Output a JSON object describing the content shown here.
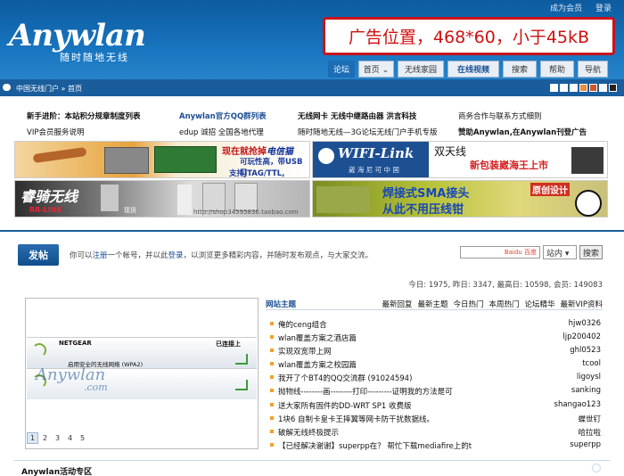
{
  "header": {
    "top_links": [
      "成为会员",
      "登录"
    ],
    "logo_text": "Anywlan",
    "logo_sub": "随时随地无线",
    "ad_text": "广告位置，468*60，小于45kB"
  },
  "nav": [
    "论坛",
    "首页 ⌄",
    "无线家园",
    "在线视频",
    "搜索",
    "帮助",
    "导航"
  ],
  "breadcrumb": "中国无线门户 » 首页",
  "swatch_colors": [
    "#ffffff",
    "#ffffff",
    "#ffffff",
    "#f18a3c",
    "#d6542b",
    "#ffffff",
    "#222222"
  ],
  "links": {
    "row1": [
      "新手进阶：本站积分规章制度列表",
      "Anywlan官方QQ群列表",
      "无线网卡 无线中继路由器 洪言科技",
      "商务合作与联系方式细则"
    ],
    "row2": [
      "VIP会员服务说明",
      "edup 诚招 全国各地代理",
      "随时随地无线—3G论坛无线门户手机专版",
      "赞助Anywlan,在Anywlan刊登广告"
    ]
  },
  "banners": {
    "b1_line1": "现在就抢掉",
    "b1_brand": "电信猫",
    "b1_line2": "可玩性高，带USB口",
    "b1_line3": "支持JTAG/TTL, Telnet",
    "b2_brand": "WIFI-Link",
    "b2_sub": "崴 海 尼 可 中 国",
    "b2_tag": "双天线",
    "b2_slogan": "新包装崴海王上市",
    "b3_title": "睿骑无线",
    "b3_sub": "RR-LINK",
    "b3_url": "http://shop34595836.taobao.com",
    "b3_mid": "现货",
    "b4_line1": "焊接式SMA接头",
    "b4_line2": "从此不用压线钳",
    "b4_tag": "原创设计"
  },
  "post": {
    "button": "发帖",
    "msg_pre": "你可以",
    "msg_reg": "注册",
    "msg_mid": "一个帐号，并以此",
    "msg_login": "登录",
    "msg_post": "，以浏览更多精彩内容，并随时发布观点，与大家交流。",
    "search_logo": "Baidu 百度",
    "search_scope": "站内 ▾",
    "search_button": "搜索"
  },
  "stats": "今日: 1975, 昨日: 3347, 最高日: 10598, 会员: 149083",
  "image_box": {
    "brand": "NETGEAR",
    "connected": "已连接上",
    "network": "启用安全的无线网络 (WPA2)",
    "watermark": "Anywlan",
    "watermark_sub": ".com",
    "pages": [
      "1",
      "2",
      "3",
      "4",
      "5"
    ]
  },
  "thread_tabs": {
    "title": "网站主题",
    "tabs": [
      "最新回复",
      "最新主题",
      "今日热门",
      "本周热门",
      "论坛精华",
      "最新VIP资料"
    ]
  },
  "threads": [
    {
      "title": "俺的ceng组合",
      "user": "hjw0326"
    },
    {
      "title": "wlan覆盖方案之酒店篇",
      "user": "ljp200402"
    },
    {
      "title": "实现双宽带上网",
      "user": "ghl0523"
    },
    {
      "title": "wlan覆盖方案之校园篇",
      "user": "tcool"
    },
    {
      "title": "我开了个BT4的QQ交流群 (91024594)",
      "user": "ligoysl"
    },
    {
      "title": "抛物线--------画--------打印---------证明我的方法是可",
      "user": "sanking"
    },
    {
      "title": "送大家所有固件的DD-WRT SP1 收费版",
      "user": "shangao123"
    },
    {
      "title": "1块6 自制卡皇卡王摔翼等网卡防干扰数据线。",
      "user": "蝶世钉"
    },
    {
      "title": "破解无线终极提示",
      "user": "哈拉啦"
    },
    {
      "title": "【已经解决谢谢】superpp在？ 帮忙下载mediafire上的t",
      "user": "superpp"
    }
  ],
  "bottom_section": "Anywlan活动专区"
}
